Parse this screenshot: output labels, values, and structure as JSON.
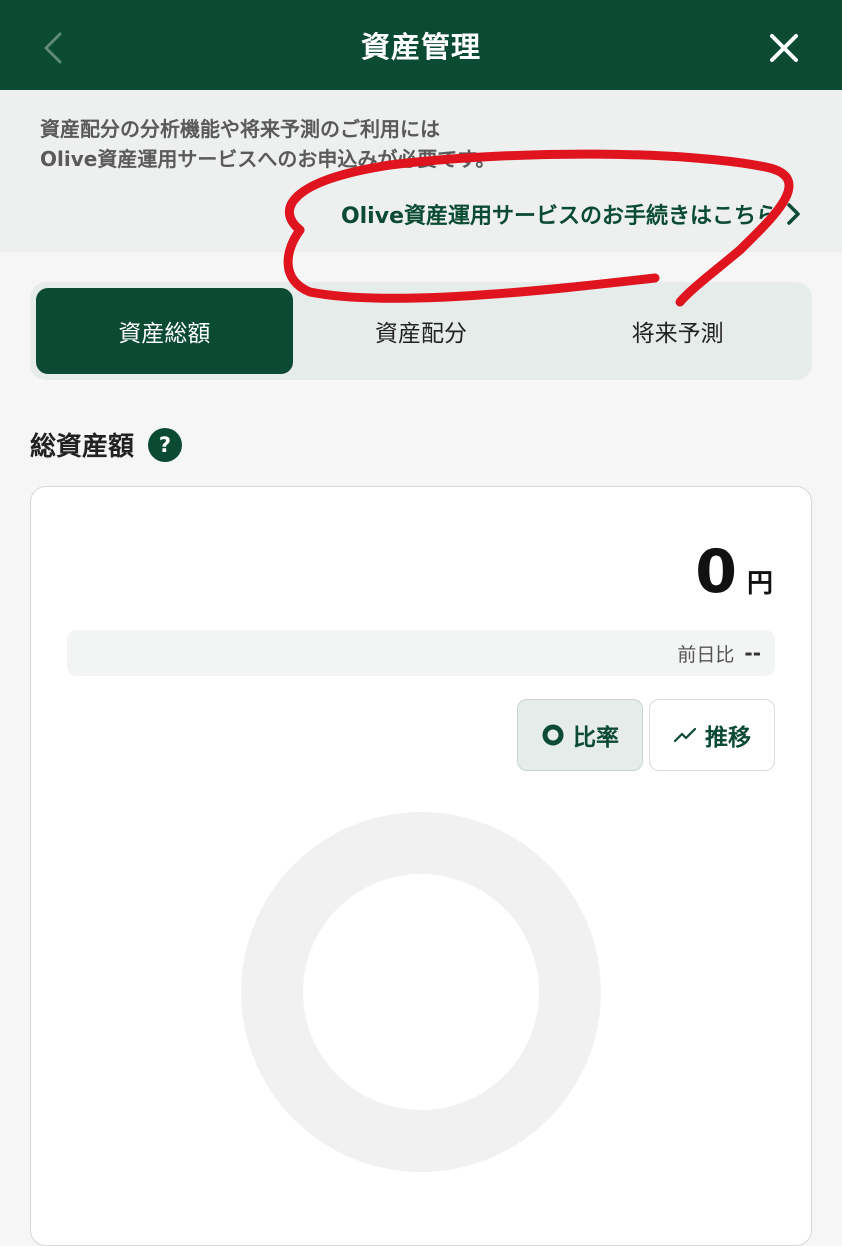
{
  "header": {
    "title": "資産管理"
  },
  "notice": {
    "line1": "資産配分の分析機能や将来予測のご利用には",
    "line2": "Olive資産運用サービスへのお申込みが必要です。",
    "link_label": "Olive資産運用サービスのお手続きはこちら"
  },
  "tabs": [
    {
      "label": "資産総額",
      "active": true
    },
    {
      "label": "資産配分",
      "active": false
    },
    {
      "label": "将来予測",
      "active": false
    }
  ],
  "section": {
    "title": "総資産額",
    "help_icon_text": "?"
  },
  "summary": {
    "amount": "0",
    "unit": "円",
    "diff_label": "前日比",
    "diff_value": "--"
  },
  "view_toggle": {
    "ratio_label": "比率",
    "trend_label": "推移",
    "selected": "ratio"
  },
  "colors": {
    "brand": "#0b4a33",
    "annotation": "#e0141e",
    "donut_empty": "#f1f1f1"
  },
  "icons": {
    "back": "chevron-left-icon",
    "close": "close-icon",
    "link_arrow": "chevron-right-icon",
    "ratio": "donut-icon",
    "trend": "trend-line-icon",
    "help": "question-circle-icon"
  }
}
